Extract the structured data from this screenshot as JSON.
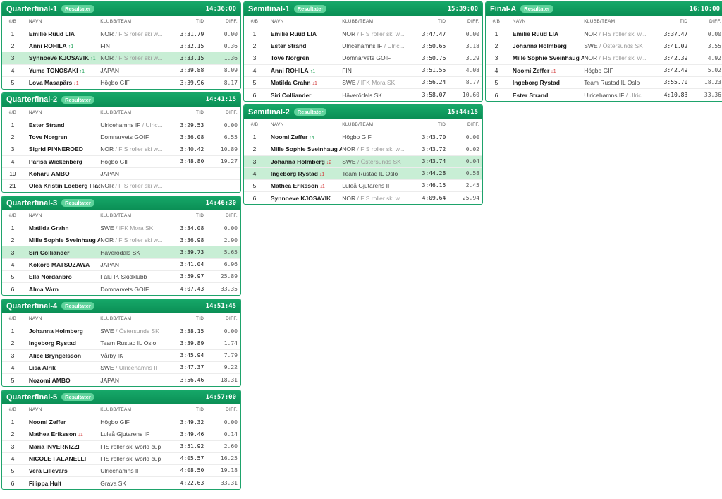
{
  "columns": {
    "rank": "#/B",
    "name": "NAVN",
    "club": "KLUBB/TEAM",
    "time": "TID",
    "diff": "DIFF."
  },
  "badge": "Resultater",
  "heats": [
    {
      "col": 1,
      "title": "Quarterfinal-1",
      "time": "14:36:00",
      "rows": [
        {
          "rank": "1",
          "name": "Emilie Ruud LIA",
          "club": "NOR",
          "club2": "FIS roller ski w...",
          "time": "3:31.79",
          "diff": "0.00"
        },
        {
          "rank": "2",
          "name": "Anni ROHILA",
          "arrow": "up",
          "arrow_text": "↑1",
          "club": "FIN",
          "time": "3:32.15",
          "diff": "0.36"
        },
        {
          "rank": "3",
          "name": "Synnoeve KJOSAVIK",
          "arrow": "up",
          "arrow_text": "↑1",
          "club": "NOR",
          "club2": "FIS roller ski w...",
          "time": "3:33.15",
          "diff": "1.36",
          "hl": true
        },
        {
          "rank": "4",
          "name": "Yume TONOSAKI",
          "arrow": "up",
          "arrow_text": "↑1",
          "club": "JAPAN",
          "time": "3:39.88",
          "diff": "8.09"
        },
        {
          "rank": "5",
          "name": "Lova Masapärs",
          "arrow": "down",
          "arrow_text": "↓1",
          "club": "Högbo GIF",
          "time": "3:39.96",
          "diff": "8.17"
        }
      ]
    },
    {
      "col": 1,
      "title": "Quarterfinal-2",
      "time": "14:41:15",
      "rows": [
        {
          "rank": "1",
          "name": "Ester Strand",
          "club": "Ulricehamns IF",
          "club2": "Ulric...",
          "time": "3:29.53",
          "diff": "0.00"
        },
        {
          "rank": "2",
          "name": "Tove Norgren",
          "club": "Domnarvets GOIF",
          "time": "3:36.08",
          "diff": "6.55"
        },
        {
          "rank": "3",
          "name": "Sigrid PINNEROED",
          "club": "NOR",
          "club2": "FIS roller ski w...",
          "time": "3:40.42",
          "diff": "10.89"
        },
        {
          "rank": "4",
          "name": "Parisa Wickenberg",
          "club": "Högbo GIF",
          "time": "3:48.80",
          "diff": "19.27"
        },
        {
          "rank": "19",
          "name": "Koharu AMBO",
          "club": "JAPAN",
          "time": "",
          "diff": ""
        },
        {
          "rank": "21",
          "name": "Olea Kristin Loeberg Flad...",
          "club": "NOR",
          "club2": "FIS roller ski w...",
          "time": "",
          "diff": ""
        }
      ]
    },
    {
      "col": 1,
      "title": "Quarterfinal-3",
      "time": "14:46:30",
      "rows": [
        {
          "rank": "1",
          "name": "Matilda Grahn",
          "club": "SWE",
          "club2": "IFK Mora SK",
          "time": "3:34.08",
          "diff": "0.00"
        },
        {
          "rank": "2",
          "name": "Mille Sophie Sveinhaug A...",
          "club": "NOR",
          "club2": "FIS roller ski w...",
          "time": "3:36.98",
          "diff": "2.90"
        },
        {
          "rank": "3",
          "name": "Siri Colliander",
          "club": "Häverödals SK",
          "time": "3:39.73",
          "diff": "5.65",
          "hl": true
        },
        {
          "rank": "4",
          "name": "Kokoro MATSUZAWA",
          "club": "JAPAN",
          "time": "3:41.04",
          "diff": "6.96"
        },
        {
          "rank": "5",
          "name": "Ella Nordanbro",
          "club": "Falu IK Skidklubb",
          "time": "3:59.97",
          "diff": "25.89"
        },
        {
          "rank": "6",
          "name": "Alma Vårn",
          "club": "Domnarvets GOIF",
          "time": "4:07.43",
          "diff": "33.35"
        }
      ]
    },
    {
      "col": 1,
      "title": "Quarterfinal-4",
      "time": "14:51:45",
      "rows": [
        {
          "rank": "1",
          "name": "Johanna Holmberg",
          "club": "SWE",
          "club2": "Östersunds SK",
          "time": "3:38.15",
          "diff": "0.00"
        },
        {
          "rank": "2",
          "name": "Ingeborg Rystad",
          "club": "Team Rustad IL Oslo",
          "time": "3:39.89",
          "diff": "1.74"
        },
        {
          "rank": "3",
          "name": "Alice Bryngelsson",
          "club": "Vårby IK",
          "time": "3:45.94",
          "diff": "7.79"
        },
        {
          "rank": "4",
          "name": "Lisa Alrik",
          "club": "SWE",
          "club2": "Ulricehamns IF",
          "time": "3:47.37",
          "diff": "9.22"
        },
        {
          "rank": "5",
          "name": "Nozomi AMBO",
          "club": "JAPAN",
          "time": "3:56.46",
          "diff": "18.31"
        }
      ]
    },
    {
      "col": 1,
      "title": "Quarterfinal-5",
      "time": "14:57:00",
      "rows": [
        {
          "rank": "1",
          "name": "Noomi Zeffer",
          "club": "Högbo GIF",
          "time": "3:49.32",
          "diff": "0.00"
        },
        {
          "rank": "2",
          "name": "Mathea Eriksson",
          "arrow": "down",
          "arrow_text": "↓1",
          "club": "Luleå Gjutarens IF",
          "time": "3:49.46",
          "diff": "0.14"
        },
        {
          "rank": "3",
          "name": "Maria INVERNIZZI",
          "club": "FIS roller ski world cup",
          "time": "3:51.92",
          "diff": "2.60"
        },
        {
          "rank": "4",
          "name": "NICOLE FALANELLI",
          "club": "FIS roller ski world cup",
          "time": "4:05.57",
          "diff": "16.25"
        },
        {
          "rank": "5",
          "name": "Vera Lillevars",
          "club": "Ulricehamns IF",
          "time": "4:08.50",
          "diff": "19.18"
        },
        {
          "rank": "6",
          "name": "Filippa Hult",
          "club": "Grava SK",
          "time": "4:22.63",
          "diff": "33.31"
        }
      ]
    },
    {
      "col": 2,
      "title": "Semifinal-1",
      "time": "15:39:00",
      "rows": [
        {
          "rank": "1",
          "name": "Emilie Ruud LIA",
          "club": "NOR",
          "club2": "FIS roller ski w...",
          "time": "3:47.47",
          "diff": "0.00"
        },
        {
          "rank": "2",
          "name": "Ester Strand",
          "club": "Ulricehamns IF",
          "club2": "Ulric...",
          "time": "3:50.65",
          "diff": "3.18"
        },
        {
          "rank": "3",
          "name": "Tove Norgren",
          "club": "Domnarvets GOIF",
          "time": "3:50.76",
          "diff": "3.29"
        },
        {
          "rank": "4",
          "name": "Anni ROHILA",
          "arrow": "up",
          "arrow_text": "↑1",
          "club": "FIN",
          "time": "3:51.55",
          "diff": "4.08"
        },
        {
          "rank": "5",
          "name": "Matilda Grahn",
          "arrow": "down",
          "arrow_text": "↓1",
          "club": "SWE",
          "club2": "IFK Mora SK",
          "time": "3:56.24",
          "diff": "8.77"
        },
        {
          "rank": "6",
          "name": "Siri Colliander",
          "club": "Häverödals SK",
          "time": "3:58.07",
          "diff": "10.60"
        }
      ]
    },
    {
      "col": 2,
      "title": "Semifinal-2",
      "time": "15:44:15",
      "rows": [
        {
          "rank": "1",
          "name": "Noomi Zeffer",
          "arrow": "up",
          "arrow_text": "↑4",
          "club": "Högbo GIF",
          "time": "3:43.70",
          "diff": "0.00"
        },
        {
          "rank": "2",
          "name": "Mille Sophie Sveinhaug A...",
          "club": "NOR",
          "club2": "FIS roller ski w...",
          "time": "3:43.72",
          "diff": "0.02"
        },
        {
          "rank": "3",
          "name": "Johanna Holmberg",
          "arrow": "down",
          "arrow_text": "↓2",
          "club": "SWE",
          "club2": "Östersunds SK",
          "time": "3:43.74",
          "diff": "0.04",
          "hl": true
        },
        {
          "rank": "4",
          "name": "Ingeborg Rystad",
          "arrow": "down",
          "arrow_text": "↓1",
          "club": "Team Rustad IL Oslo",
          "time": "3:44.28",
          "diff": "0.58",
          "hl": true
        },
        {
          "rank": "5",
          "name": "Mathea Eriksson",
          "arrow": "down",
          "arrow_text": "↓1",
          "club": "Luleå Gjutarens IF",
          "time": "3:46.15",
          "diff": "2.45"
        },
        {
          "rank": "6",
          "name": "Synnoeve KJOSAVIK",
          "club": "NOR",
          "club2": "FIS roller ski w...",
          "time": "4:09.64",
          "diff": "25.94"
        }
      ]
    },
    {
      "col": 3,
      "title": "Final-A",
      "time": "16:10:00",
      "rows": [
        {
          "rank": "1",
          "name": "Emilie Ruud LIA",
          "club": "NOR",
          "club2": "FIS roller ski w...",
          "time": "3:37.47",
          "diff": "0.00"
        },
        {
          "rank": "2",
          "name": "Johanna Holmberg",
          "club": "SWE",
          "club2": "Östersunds SK",
          "time": "3:41.02",
          "diff": "3.55"
        },
        {
          "rank": "3",
          "name": "Mille Sophie Sveinhaug A...",
          "club": "NOR",
          "club2": "FIS roller ski w...",
          "time": "3:42.39",
          "diff": "4.92"
        },
        {
          "rank": "4",
          "name": "Noomi Zeffer",
          "arrow": "down",
          "arrow_text": "↓1",
          "club": "Högbo GIF",
          "time": "3:42.49",
          "diff": "5.02"
        },
        {
          "rank": "5",
          "name": "Ingeborg Rystad",
          "club": "Team Rustad IL Oslo",
          "time": "3:55.70",
          "diff": "18.23"
        },
        {
          "rank": "6",
          "name": "Ester Strand",
          "club": "Ulricehamns IF",
          "club2": "Ulric...",
          "time": "4:10.83",
          "diff": "33.36"
        }
      ]
    }
  ]
}
